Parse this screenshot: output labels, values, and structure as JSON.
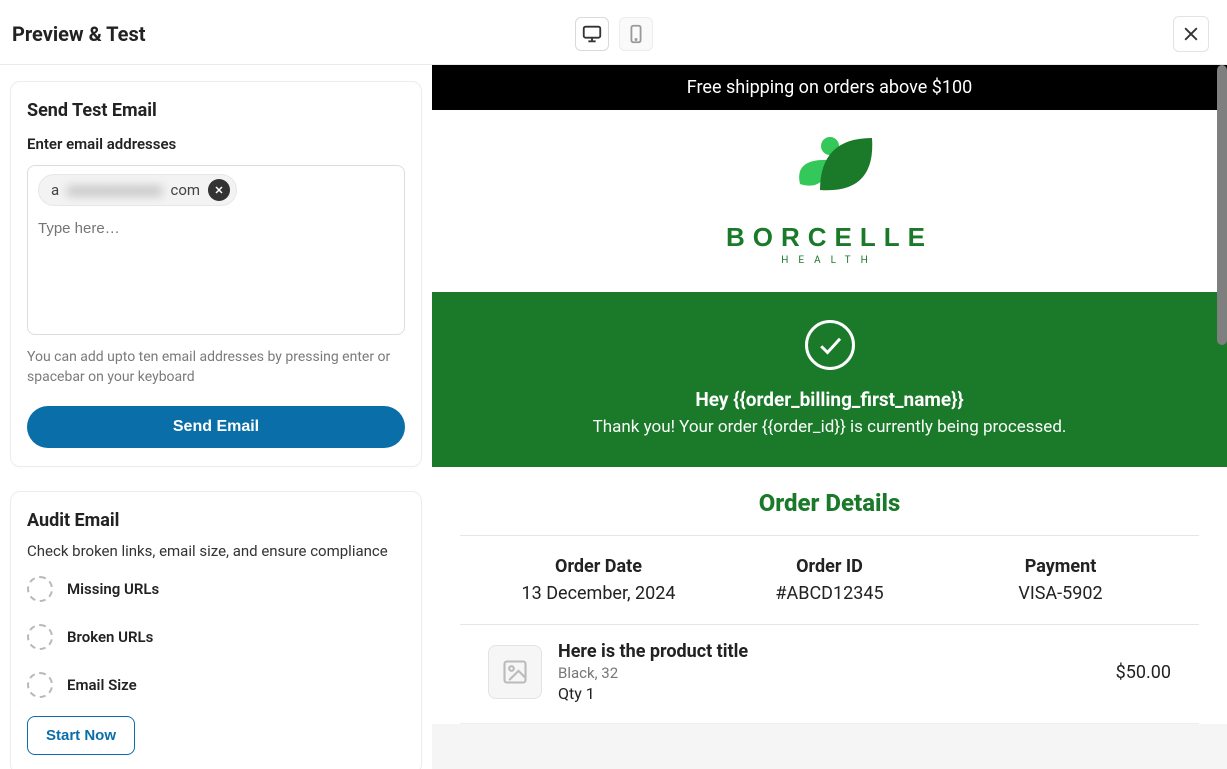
{
  "header": {
    "title": "Preview & Test"
  },
  "device_toggle": {
    "desktop_label": "desktop",
    "mobile_label": "mobile"
  },
  "send_panel": {
    "title": "Send Test Email",
    "field_label": "Enter email addresses",
    "chip_prefix": "a",
    "chip_suffix": "com",
    "placeholder": "Type here…",
    "hint": "You can add upto ten email addresses by pressing enter or spacebar on your keyboard",
    "button_label": "Send Email"
  },
  "audit_panel": {
    "title": "Audit Email",
    "subtitle": "Check broken links, email size, and ensure compliance",
    "items": [
      {
        "label": "Missing URLs"
      },
      {
        "label": "Broken URLs"
      },
      {
        "label": "Email Size"
      }
    ],
    "button_label": "Start Now"
  },
  "email_preview": {
    "banner": "Free shipping on orders above $100",
    "brand": {
      "name": "BORCELLE",
      "sub": "HEALTH",
      "accent": "#1a7a2a",
      "accent_light": "#34c759"
    },
    "hero": {
      "line1": "Hey {{order_billing_first_name}}",
      "line2": "Thank you! Your order {{order_id}} is currently being processed."
    },
    "details": {
      "heading": "Order Details",
      "cols": [
        {
          "label": "Order Date",
          "value": "13 December, 2024"
        },
        {
          "label": "Order ID",
          "value": "#ABCD12345"
        },
        {
          "label": "Payment",
          "value": "VISA-5902"
        }
      ]
    },
    "product": {
      "title": "Here is the product title",
      "variant": "Black, 32",
      "qty": "Qty 1",
      "price": "$50.00"
    }
  }
}
